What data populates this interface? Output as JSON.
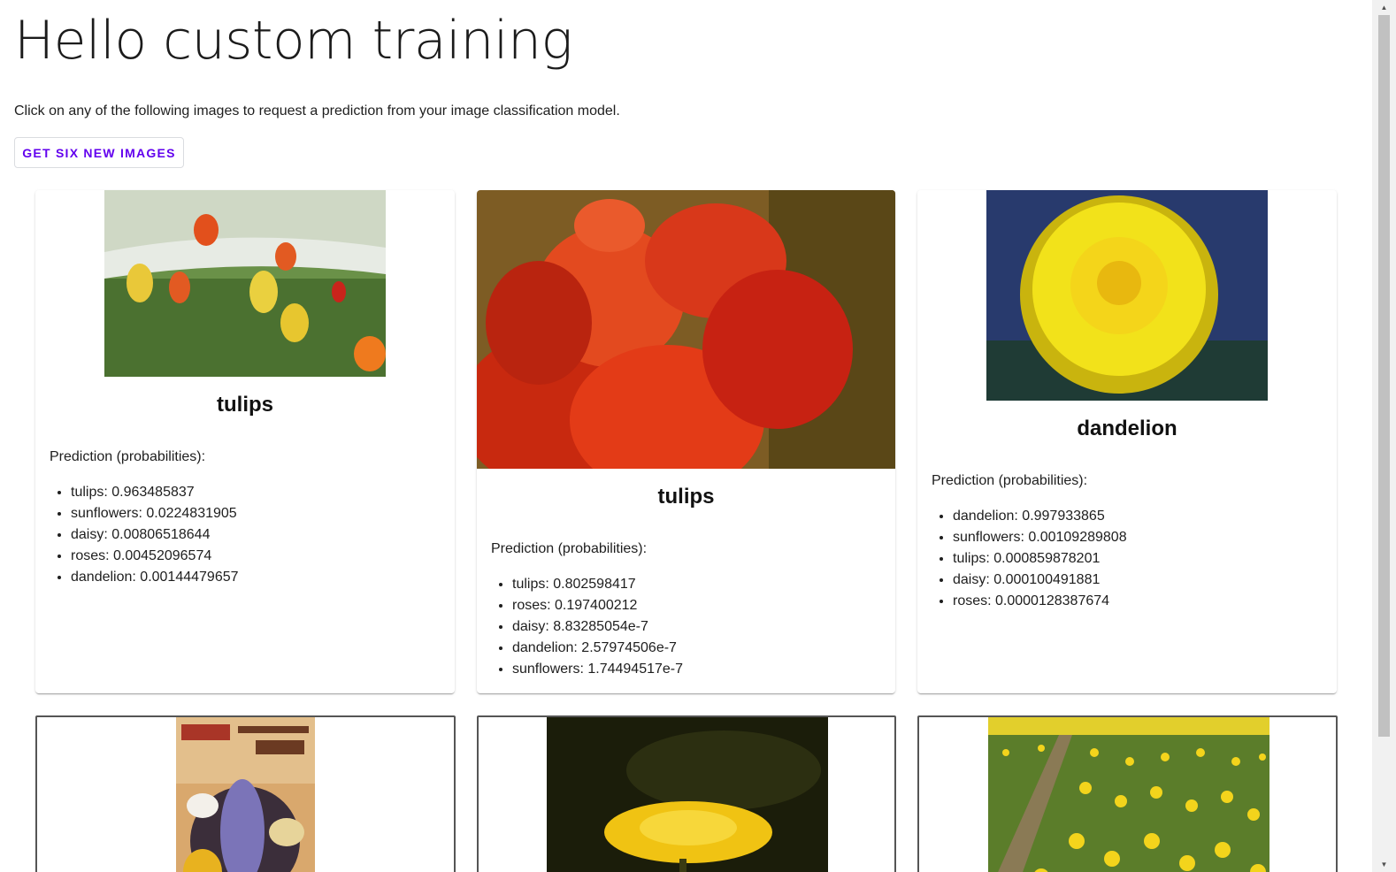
{
  "page": {
    "title": "Hello custom training",
    "intro": "Click on any of the following images to request a prediction from your image classification model.",
    "button_label": "GET SIX NEW IMAGES"
  },
  "cards": [
    {
      "label": "tulips",
      "prediction_title": "Prediction (probabilities):",
      "probabilities": [
        "tulips: 0.963485837",
        "sunflowers: 0.0224831905",
        "daisy: 0.00806518644",
        "roses: 0.00452096574",
        "dandelion: 0.00144479657"
      ]
    },
    {
      "label": "tulips",
      "prediction_title": "Prediction (probabilities):",
      "probabilities": [
        "tulips: 0.802598417",
        "roses: 0.197400212",
        "daisy: 8.83285054e-7",
        "dandelion: 2.57974506e-7",
        "sunflowers: 1.74494517e-7"
      ]
    },
    {
      "label": "dandelion",
      "prediction_title": "Prediction (probabilities):",
      "probabilities": [
        "dandelion: 0.997933865",
        "sunflowers: 0.00109289808",
        "tulips: 0.000859878201",
        "daisy: 0.000100491881",
        "roses: 0.0000128387674"
      ]
    }
  ],
  "images": [
    {
      "name": "tulip-garden-photo",
      "colors": [
        "#4f7a34",
        "#e9c839",
        "#e25a22"
      ]
    },
    {
      "name": "red-tulips-photo",
      "colors": [
        "#7d5c24",
        "#e33b17",
        "#b9240f"
      ]
    },
    {
      "name": "dandelion-photo",
      "colors": [
        "#283a6d",
        "#f2e21a",
        "#c9b40e"
      ]
    },
    {
      "name": "bulbs-catalog-cover",
      "colors": [
        "#d9a86d",
        "#7b74b8",
        "#e7d49a"
      ]
    },
    {
      "name": "dandelion-dark-photo",
      "colors": [
        "#1b1d0a",
        "#f0c313",
        "#3a3b12"
      ]
    },
    {
      "name": "tulip-field-photo",
      "colors": [
        "#5b7d2a",
        "#f3d41c",
        "#2f4a1a"
      ]
    }
  ],
  "colors": {
    "accent": "#6200ee"
  }
}
